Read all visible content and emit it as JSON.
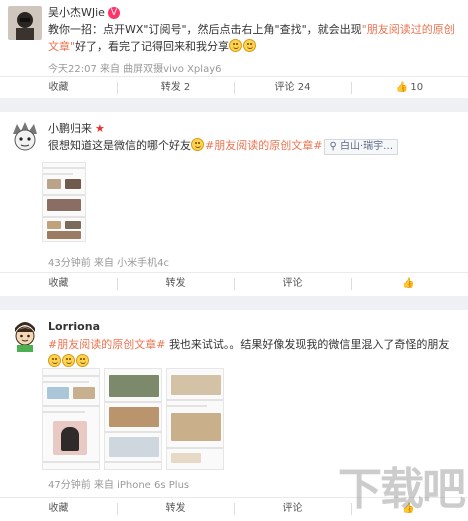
{
  "posts": [
    {
      "username": "吴小杰WJie",
      "text_parts": [
        "教你一招：点开WX\"订阅号\"，然后点击右上角\"查找\"，就会出现",
        "\"朋友阅读过的原创文章\"",
        "好了，看完了记得回来和我分享"
      ],
      "meta": "今天22:07 来自 曲屏双摄vivo Xplay6",
      "actions": {
        "favorite": "收藏",
        "repost": "转发 2",
        "comment": "评论 24",
        "like": "10"
      }
    },
    {
      "username": "小鹏归来",
      "text_parts": [
        "很想知道这是微信的哪个好友",
        "#朋友阅读的原创文章#"
      ],
      "location": "白山·瑞宇…",
      "meta": "43分钟前 来自 小米手机4c",
      "actions": {
        "favorite": "收藏",
        "repost": "转发",
        "comment": "评论",
        "like": ""
      }
    },
    {
      "username": "Lorriona",
      "text_parts": [
        "#朋友阅读的原创文章#",
        "我也来试试。。结果好像发现我的微信里混入了奇怪的朋友"
      ],
      "meta": "47分钟前 来自 iPhone 6s Plus",
      "actions": {
        "favorite": "收藏",
        "repost": "转发",
        "comment": "评论",
        "like": ""
      }
    }
  ],
  "watermark": "下载吧",
  "colors": {
    "topic": "#eb7350",
    "verified_badge": "#ff3366",
    "star": "#e9322e"
  },
  "icons": {
    "verified": "verified-badge-icon",
    "star": "star-icon",
    "location": "location-pin-icon",
    "like": "thumbs-up-icon"
  }
}
